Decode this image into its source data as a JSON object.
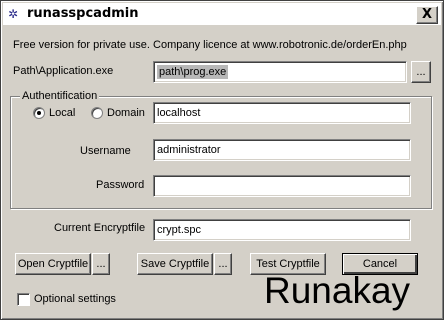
{
  "window": {
    "title": "runasspcadmin",
    "close_glyph": "X",
    "app_icon": "runas-app-icon"
  },
  "notice": "Free version for private use. Company licence at www.robotronic.de/orderEn.php",
  "path": {
    "label": "Path\\Application.exe",
    "value": "path\\prog.exe",
    "browse_label": "..."
  },
  "auth": {
    "group_label": "Authentification",
    "radio_local": "Local",
    "radio_domain": "Domain",
    "selected": "Local",
    "domain_value": "localhost",
    "username_label": "Username",
    "username_value": "administrator",
    "password_label": "Password",
    "password_value": ""
  },
  "cryptfile": {
    "label": "Current Encryptfile",
    "value": "crypt.spc"
  },
  "buttons": {
    "open": "Open Cryptfile",
    "open_more": "...",
    "save": "Save Cryptfile",
    "save_more": "...",
    "test": "Test Cryptfile",
    "cancel": "Cancel"
  },
  "optional": {
    "label": "Optional settings",
    "checked": false
  },
  "brand": "Runakay"
}
